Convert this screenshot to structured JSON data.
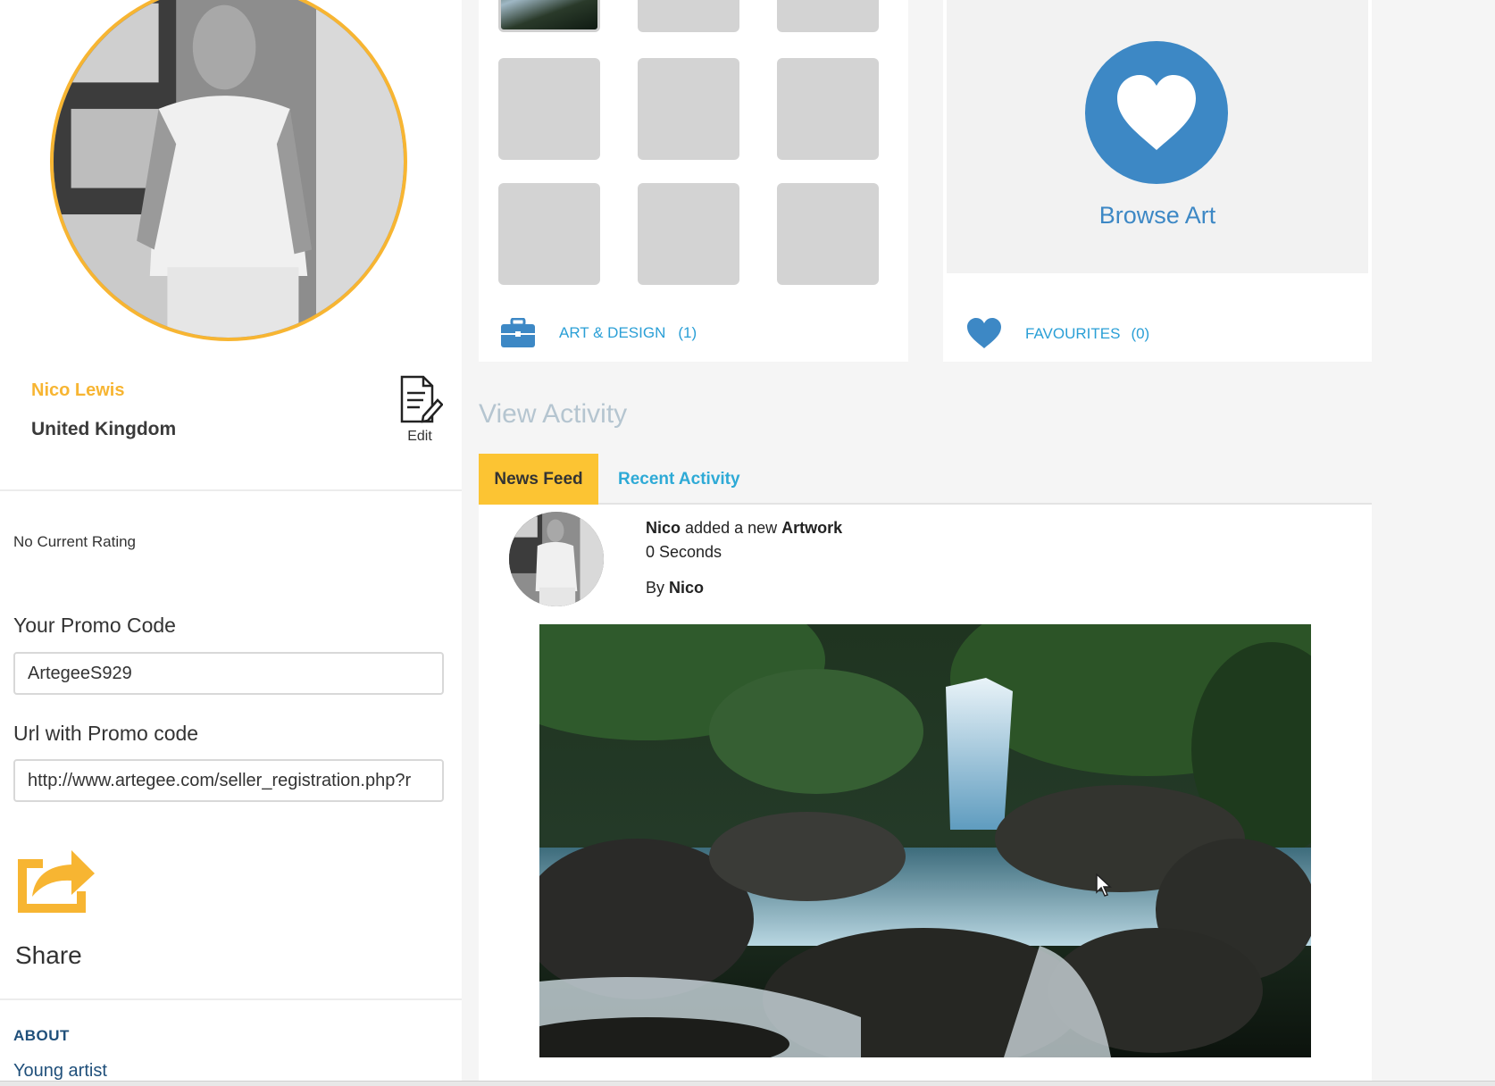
{
  "profile": {
    "name": "Nico Lewis",
    "country": "United Kingdom",
    "edit_label": "Edit",
    "avatar_icon": "profile-photo",
    "rating_text": "No Current Rating"
  },
  "promo": {
    "code_label": "Your Promo Code",
    "code_value": "ArtegeeS929",
    "url_label": "Url with Promo code",
    "url_value": "http://www.artegee.com/seller_registration.php?r"
  },
  "share": {
    "label": "Share",
    "icon": "share-arrow-icon"
  },
  "about": {
    "title": "ABOUT",
    "text": "Young artist"
  },
  "art_design": {
    "label": "ART & DESIGN",
    "count": "(1)",
    "icon": "briefcase-icon"
  },
  "favourites": {
    "label": "FAVOURITES",
    "count": "(0)",
    "browse_label": "Browse Art",
    "icon": "heart-icon"
  },
  "activity": {
    "title": "View Activity",
    "tabs": [
      {
        "label": "News Feed",
        "active": true
      },
      {
        "label": "Recent Activity",
        "active": false
      }
    ],
    "feed_item": {
      "user": "Nico",
      "action": "added a new",
      "object": "Artwork",
      "time": "0 Seconds",
      "by_prefix": "By",
      "by_user": "Nico"
    }
  },
  "colors": {
    "accent_orange": "#f7b532",
    "tab_yellow": "#fcc433",
    "link_blue": "#2a9fd6",
    "browse_blue": "#3d88c5",
    "about_navy": "#1f4f7a"
  }
}
